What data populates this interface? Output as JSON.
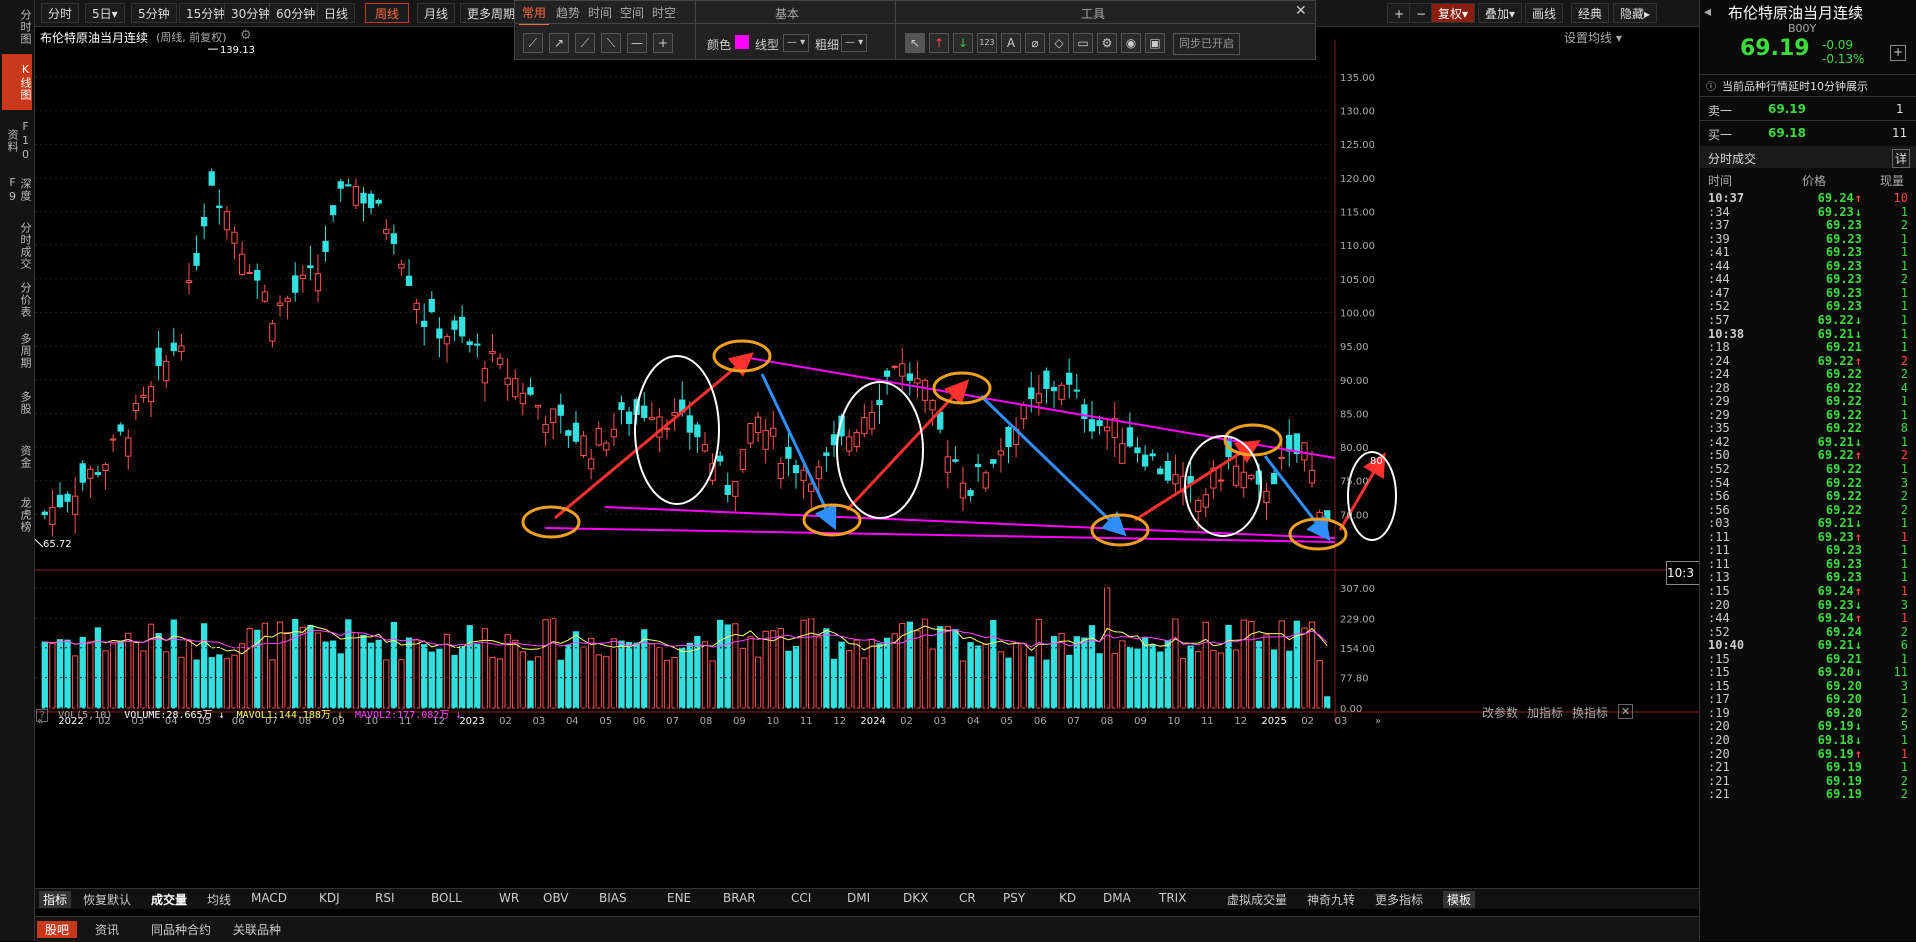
{
  "left_nav": [
    "分时图",
    "K线图",
    "F10资料",
    "深度F9",
    "分时成交",
    "分价表",
    "多周期",
    "多股",
    "资金",
    "龙虎榜"
  ],
  "toolbar": {
    "periods": [
      "分时",
      "5日▾",
      "5分钟",
      "15分钟",
      "30分钟",
      "60分钟",
      "日线",
      "周线",
      "月线",
      "更多周期"
    ],
    "active_period": "周线",
    "right_buttons": [
      "+",
      "−",
      "复权▾",
      "叠加▾",
      "画线",
      "经典",
      "隐藏▸"
    ]
  },
  "toolbox": {
    "tabs": [
      "常用",
      "趋势",
      "时间",
      "空间",
      "时空"
    ],
    "section_basic": "基本",
    "section_tools": "工具",
    "color_label": "颜色",
    "line_type_label": "线型",
    "thickness_label": "粗细",
    "sync_label": "同步已开启",
    "close": "✕",
    "color": "#ff00ff"
  },
  "chart_header": {
    "title": "布伦特原油当月连续",
    "subtitle": "(周线, 前复权)",
    "settings": "设置均线 ▾"
  },
  "chart_data": {
    "type": "candlestick",
    "price_axis": [
      "135.00",
      "130.00",
      "125.00",
      "120.00",
      "115.00",
      "110.00",
      "105.00",
      "100.00",
      "95.00",
      "90.00",
      "85.00",
      "80.00",
      "75.00",
      "70.00"
    ],
    "ylim": [
      65,
      139
    ],
    "high_label": "139.13",
    "low_label": "65.72",
    "x_labels": [
      "2022",
      "02",
      "03",
      "04",
      "05",
      "06",
      "07",
      "08",
      "09",
      "10",
      "11",
      "12",
      "2023",
      "02",
      "03",
      "04",
      "05",
      "06",
      "07",
      "08",
      "09",
      "10",
      "11",
      "12",
      "2024",
      "02",
      "03",
      "04",
      "05",
      "06",
      "07",
      "08",
      "09",
      "10",
      "11",
      "12",
      "2025",
      "02",
      "03"
    ],
    "vol_axis": [
      "307.00",
      "229.00",
      "154.00",
      "77.80",
      "0.00"
    ],
    "vol_ylim": [
      0,
      307
    ]
  },
  "volume_header": {
    "label": "VOL(5,10)",
    "volume": "VOLUME:28.665万",
    "mavol1": "MAVOL1:144.188万",
    "mavol2": "MAVOL2:177.082万",
    "actions": [
      "改参数",
      "加指标",
      "换指标"
    ]
  },
  "price_tag": "10:3",
  "price_tag_value": "80",
  "indicator_tabs": [
    "指标",
    "恢复默认",
    "成交量",
    "均线",
    "MACD",
    "KDJ",
    "RSI",
    "BOLL",
    "WR",
    "OBV",
    "BIAS",
    "ENE",
    "BRAR",
    "CCI",
    "DMI",
    "DKX",
    "CR",
    "PSY",
    "KD",
    "DMA",
    "TRIX",
    "虚拟成交量",
    "神奇九转",
    "更多指标",
    "模板"
  ],
  "footer_tabs": [
    "股吧",
    "资讯",
    "同品种合约",
    "关联品种"
  ],
  "quote": {
    "name": "布伦特原油当月连续",
    "code": "B00Y",
    "price": "69.19",
    "change": "-0.09",
    "change_pct": "-0.13%",
    "notice": "当前品种行情延时10分钟展示",
    "sell_label": "卖一",
    "sell_price": "69.19",
    "sell_vol": "1",
    "buy_label": "买一",
    "buy_price": "69.18",
    "buy_vol": "11",
    "ticks_title": "分时成交",
    "detail": "详",
    "col_time": "时间",
    "col_price": "价格",
    "col_vol": "现量"
  },
  "ticks": [
    {
      "t": "10:37",
      "p": "69.24",
      "d": "up",
      "v": "10"
    },
    {
      "t": ":34",
      "p": "69.23",
      "d": "down",
      "v": "1"
    },
    {
      "t": ":37",
      "p": "69.23",
      "d": "",
      "v": "2"
    },
    {
      "t": ":39",
      "p": "69.23",
      "d": "",
      "v": "1"
    },
    {
      "t": ":41",
      "p": "69.23",
      "d": "",
      "v": "1"
    },
    {
      "t": ":44",
      "p": "69.23",
      "d": "",
      "v": "1"
    },
    {
      "t": ":44",
      "p": "69.23",
      "d": "",
      "v": "2"
    },
    {
      "t": ":47",
      "p": "69.23",
      "d": "",
      "v": "1"
    },
    {
      "t": ":52",
      "p": "69.23",
      "d": "",
      "v": "1"
    },
    {
      "t": ":57",
      "p": "69.22",
      "d": "down",
      "v": "1"
    },
    {
      "t": "10:38",
      "p": "69.21",
      "d": "down",
      "v": "1"
    },
    {
      "t": ":18",
      "p": "69.21",
      "d": "",
      "v": "1"
    },
    {
      "t": ":24",
      "p": "69.22",
      "d": "up",
      "v": "2"
    },
    {
      "t": ":24",
      "p": "69.22",
      "d": "",
      "v": "2"
    },
    {
      "t": ":28",
      "p": "69.22",
      "d": "",
      "v": "4"
    },
    {
      "t": ":29",
      "p": "69.22",
      "d": "",
      "v": "1"
    },
    {
      "t": ":29",
      "p": "69.22",
      "d": "",
      "v": "1"
    },
    {
      "t": ":35",
      "p": "69.22",
      "d": "",
      "v": "8"
    },
    {
      "t": ":42",
      "p": "69.21",
      "d": "down",
      "v": "1"
    },
    {
      "t": ":50",
      "p": "69.22",
      "d": "up",
      "v": "2"
    },
    {
      "t": ":52",
      "p": "69.22",
      "d": "",
      "v": "1"
    },
    {
      "t": ":54",
      "p": "69.22",
      "d": "",
      "v": "3"
    },
    {
      "t": ":56",
      "p": "69.22",
      "d": "",
      "v": "2"
    },
    {
      "t": ":56",
      "p": "69.22",
      "d": "",
      "v": "2"
    },
    {
      "t": ":03",
      "p": "69.21",
      "d": "down",
      "v": "1"
    },
    {
      "t": ":11",
      "p": "69.23",
      "d": "up",
      "v": "1"
    },
    {
      "t": ":11",
      "p": "69.23",
      "d": "",
      "v": "1"
    },
    {
      "t": ":11",
      "p": "69.23",
      "d": "",
      "v": "1"
    },
    {
      "t": ":13",
      "p": "69.23",
      "d": "",
      "v": "1"
    },
    {
      "t": ":15",
      "p": "69.24",
      "d": "up",
      "v": "1"
    },
    {
      "t": ":20",
      "p": "69.23",
      "d": "down",
      "v": "3"
    },
    {
      "t": ":44",
      "p": "69.24",
      "d": "up",
      "v": "1"
    },
    {
      "t": ":52",
      "p": "69.24",
      "d": "",
      "v": "2"
    },
    {
      "t": "10:40",
      "p": "69.21",
      "d": "down",
      "v": "6"
    },
    {
      "t": ":15",
      "p": "69.21",
      "d": "",
      "v": "1"
    },
    {
      "t": ":15",
      "p": "69.20",
      "d": "down",
      "v": "11"
    },
    {
      "t": ":15",
      "p": "69.20",
      "d": "",
      "v": "3"
    },
    {
      "t": ":17",
      "p": "69.20",
      "d": "",
      "v": "1"
    },
    {
      "t": ":19",
      "p": "69.20",
      "d": "",
      "v": "2"
    },
    {
      "t": ":20",
      "p": "69.19",
      "d": "down",
      "v": "5"
    },
    {
      "t": ":20",
      "p": "69.18",
      "d": "down",
      "v": "1"
    },
    {
      "t": ":20",
      "p": "69.19",
      "d": "up",
      "v": "1"
    },
    {
      "t": ":21",
      "p": "69.19",
      "d": "",
      "v": "1"
    },
    {
      "t": ":21",
      "p": "69.19",
      "d": "",
      "v": "2"
    },
    {
      "t": ":21",
      "p": "69.19",
      "d": "",
      "v": "2"
    }
  ]
}
